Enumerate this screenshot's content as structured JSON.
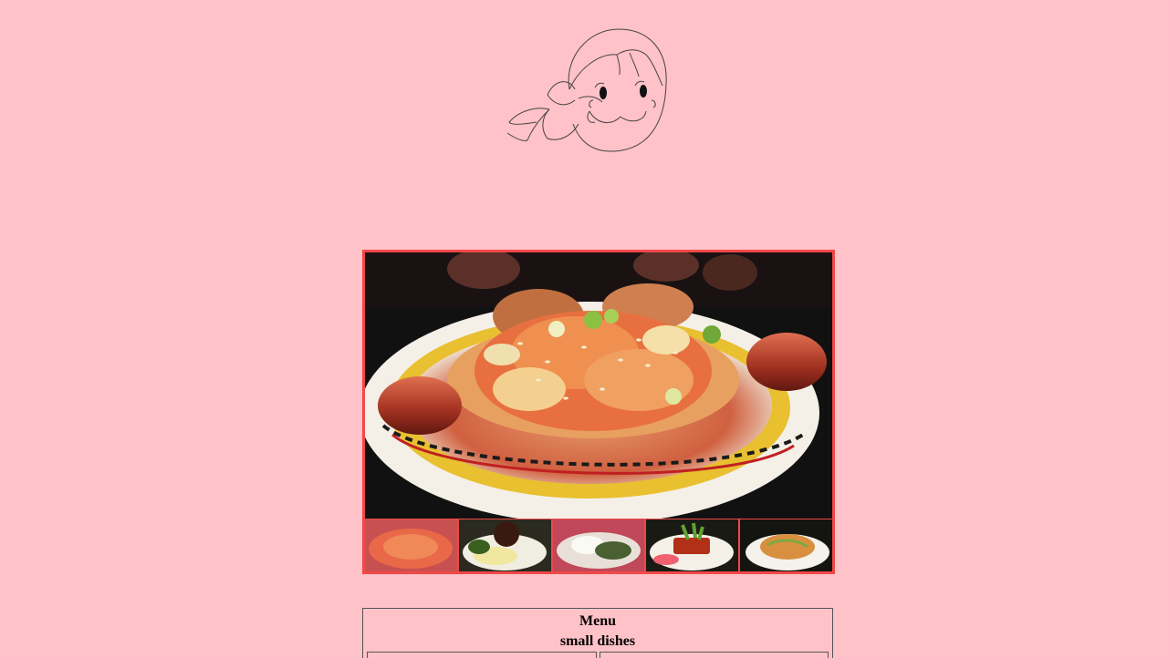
{
  "logo": {
    "icon": "girl-face-logo-icon"
  },
  "gallery": {
    "main_photo": "kimchi-hotdog-photo",
    "thumbnails": [
      {
        "name": "thumbnail-1",
        "icon": "kimchi-dish-photo"
      },
      {
        "name": "thumbnail-2",
        "icon": "dumpling-dish-photo"
      },
      {
        "name": "thumbnail-3",
        "icon": "bun-dish-photo"
      },
      {
        "name": "thumbnail-4",
        "icon": "pork-belly-dish-photo"
      },
      {
        "name": "thumbnail-5",
        "icon": "noodle-dish-photo"
      }
    ],
    "border_color": "#f04848"
  },
  "menu": {
    "title": "Menu",
    "subtitle": "small dishes"
  },
  "colors": {
    "background": "#ffc2c8"
  }
}
